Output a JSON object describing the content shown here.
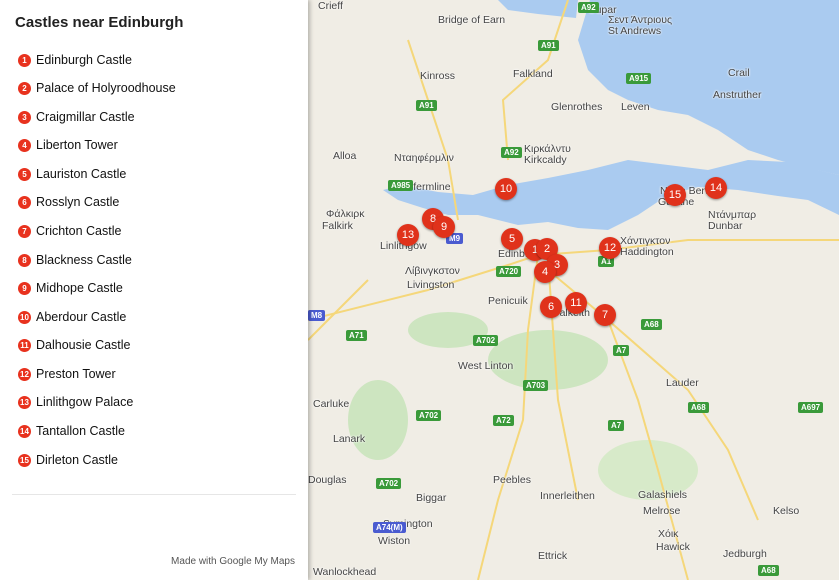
{
  "sidebar": {
    "title": "Castles near Edinburgh",
    "footer": "Made with Google My Maps",
    "items": [
      {
        "n": "1",
        "label": "Edinburgh Castle"
      },
      {
        "n": "2",
        "label": "Palace of Holyroodhouse"
      },
      {
        "n": "3",
        "label": "Craigmillar Castle"
      },
      {
        "n": "4",
        "label": "Liberton Tower"
      },
      {
        "n": "5",
        "label": "Lauriston Castle"
      },
      {
        "n": "6",
        "label": "Rosslyn Castle"
      },
      {
        "n": "7",
        "label": "Crichton Castle"
      },
      {
        "n": "8",
        "label": "Blackness Castle"
      },
      {
        "n": "9",
        "label": "Midhope Castle"
      },
      {
        "n": "10",
        "label": "Aberdour Castle"
      },
      {
        "n": "11",
        "label": "Dalhousie Castle"
      },
      {
        "n": "12",
        "label": "Preston Tower"
      },
      {
        "n": "13",
        "label": "Linlithgow Palace"
      },
      {
        "n": "14",
        "label": "Tantallon Castle"
      },
      {
        "n": "15",
        "label": "Dirleton Castle"
      }
    ]
  },
  "map": {
    "colors": {
      "marker": "#e0321b",
      "water": "#aacbf0",
      "land": "#f0ede5",
      "park": "#cde5c0"
    },
    "labels": [
      "Crieff",
      "Bridge of Earn",
      "Cupar",
      "Σεντ Άντριους",
      "St Andrews",
      "Crail",
      "Falkland",
      "Anstruther",
      "Kinross",
      "Glenrothes",
      "Leven",
      "Alloa",
      "Κιρκάλντυ",
      "Kirkcaldy",
      "Νταηφέρμλιν",
      "Dunfermline",
      "Φάλκιρκ",
      "Falkirk",
      "Linlithgow",
      "Λίβινγκστον",
      "Livingston",
      "Edinburgh",
      "Dalkeith",
      "Χάντιγκτον",
      "Haddington",
      "Ντάνμπαρ",
      "Dunbar",
      "Gullane",
      "North Berwick",
      "West Linton",
      "Carluke",
      "Lanark",
      "Penicuik",
      "Lauder",
      "Peebles",
      "Innerleithen",
      "Galashiels",
      "Melrose",
      "Kelso",
      "Biggar",
      "Symington",
      "Wiston",
      "Douglas",
      "Jedburgh",
      "Ettrick",
      "Χόικ",
      "Hawick",
      "Wanlockhead"
    ],
    "roads": [
      "A92",
      "A91",
      "A915",
      "A91",
      "A92",
      "A985",
      "M9",
      "A720",
      "A1",
      "M8",
      "A71",
      "A702",
      "A703",
      "A68",
      "A7",
      "A68",
      "A697",
      "A702",
      "A72",
      "A7",
      "A702",
      "A74(M)",
      "A68"
    ]
  }
}
